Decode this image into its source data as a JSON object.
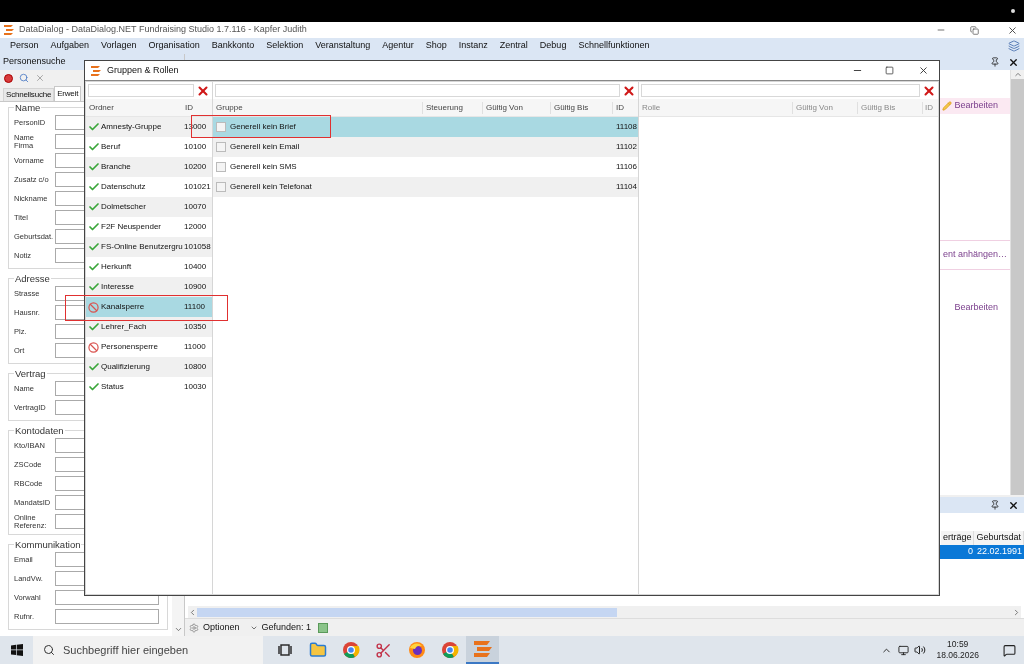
{
  "app": {
    "title": "DataDialog - DataDialog.NET Fundraising Studio 1.7.116 - Kapfer Judith",
    "menu": [
      "Person",
      "Aufgaben",
      "Vorlagen",
      "Organisation",
      "Bankkonto",
      "Selektion",
      "Veranstaltung",
      "Agentur",
      "Shop",
      "Instanz",
      "Zentral",
      "Debug",
      "Schnellfunktionen"
    ]
  },
  "search_panel": {
    "title": "Personensuche",
    "tabs": [
      {
        "label": "Schnellsuche",
        "selected": false
      },
      {
        "label": "Erweit",
        "selected": true
      }
    ],
    "groups": [
      {
        "title": "Name",
        "fields": [
          "PersonID",
          "Name Firma",
          "Vorname",
          "Zusatz c/o",
          "Nickname",
          "Titel",
          "Geburtsdat.",
          "Notiz"
        ]
      },
      {
        "title": "Adresse",
        "fields": [
          "Strasse",
          "Hausnr.",
          "Plz.",
          "Ort"
        ]
      },
      {
        "title": "Vertrag",
        "fields": [
          "Name",
          "VertragID"
        ]
      },
      {
        "title": "Kontodaten",
        "fields": [
          "Kto/IBAN",
          "ZSCode",
          "RBCode",
          "MandatsID",
          "Online Referenz:"
        ]
      },
      {
        "title": "Kommunikation",
        "fields": [
          "Email",
          "LandVw.",
          "Vorwahl",
          "Rufnr."
        ]
      }
    ]
  },
  "detail_panel": {
    "sections": [
      {
        "kind": "header",
        "link": "Bearbeiten"
      },
      {
        "kind": "attach",
        "link": "ent anhängen…"
      },
      {
        "kind": "plain",
        "link": "Bearbeiten"
      }
    ]
  },
  "results": {
    "columns": [
      "erträge",
      "Geburtsdat"
    ],
    "rows": [
      {
        "cells": [
          "0",
          "22.02.1991"
        ],
        "selected": true
      }
    ],
    "toolbar": {
      "options": "Optionen",
      "found": "Gefunden: 1"
    }
  },
  "dialog": {
    "title": "Gruppen & Rollen",
    "folders": {
      "columns": [
        "Ordner",
        "ID"
      ],
      "rows": [
        {
          "name": "Amnesty-Gruppe",
          "id": "13000",
          "blocked": false,
          "selected": false,
          "annotated": false
        },
        {
          "name": "Beruf",
          "id": "10100",
          "blocked": false,
          "selected": false,
          "annotated": false
        },
        {
          "name": "Branche",
          "id": "10200",
          "blocked": false,
          "selected": false,
          "annotated": false
        },
        {
          "name": "Datenschutz",
          "id": "101021",
          "blocked": false,
          "selected": false,
          "annotated": false
        },
        {
          "name": "Dolmetscher",
          "id": "10070",
          "blocked": false,
          "selected": false,
          "annotated": false
        },
        {
          "name": "F2F Neuspender",
          "id": "12000",
          "blocked": false,
          "selected": false,
          "annotated": false
        },
        {
          "name": "FS-Online Benutzergru",
          "id": "101058",
          "blocked": false,
          "selected": false,
          "annotated": false
        },
        {
          "name": "Herkunft",
          "id": "10400",
          "blocked": false,
          "selected": false,
          "annotated": false
        },
        {
          "name": "Interesse",
          "id": "10900",
          "blocked": false,
          "selected": false,
          "annotated": false
        },
        {
          "name": "Kanalsperre",
          "id": "11100",
          "blocked": true,
          "selected": true,
          "annotated": true
        },
        {
          "name": "Lehrer_Fach",
          "id": "10350",
          "blocked": false,
          "selected": false,
          "annotated": false
        },
        {
          "name": "Personensperre",
          "id": "11000",
          "blocked": true,
          "selected": false,
          "annotated": false
        },
        {
          "name": "Qualifizierung",
          "id": "10800",
          "blocked": false,
          "selected": false,
          "annotated": false
        },
        {
          "name": "Status",
          "id": "10030",
          "blocked": false,
          "selected": false,
          "annotated": false
        }
      ]
    },
    "groups": {
      "columns": [
        "Gruppe",
        "Steuerung",
        "Gültig Von",
        "Gültig Bis",
        "ID"
      ],
      "rows": [
        {
          "name": "Generell kein Brief",
          "id": "11108",
          "checked": false,
          "selected": true,
          "annotated": true
        },
        {
          "name": "Generell kein Email",
          "id": "11102",
          "checked": false,
          "selected": false,
          "annotated": false
        },
        {
          "name": "Generell kein SMS",
          "id": "11106",
          "checked": false,
          "selected": false,
          "annotated": false
        },
        {
          "name": "Generell kein Telefonat",
          "id": "11104",
          "checked": false,
          "selected": false,
          "annotated": false
        }
      ]
    },
    "roles": {
      "columns": [
        "Rolle",
        "Gültig Von",
        "Gültig Bis",
        "ID"
      ]
    }
  },
  "taskbar": {
    "search_placeholder": "Suchbegriff hier eingeben",
    "apps": [
      {
        "kind": "taskview",
        "active": false
      },
      {
        "kind": "explorer",
        "active": false
      },
      {
        "kind": "chrome",
        "active": false
      },
      {
        "kind": "snip",
        "active": false
      },
      {
        "kind": "firefox",
        "active": false
      },
      {
        "kind": "chrome",
        "active": false
      },
      {
        "kind": "datadialog",
        "active": true
      }
    ],
    "time": "10:59",
    "date": "18.06.2026"
  }
}
